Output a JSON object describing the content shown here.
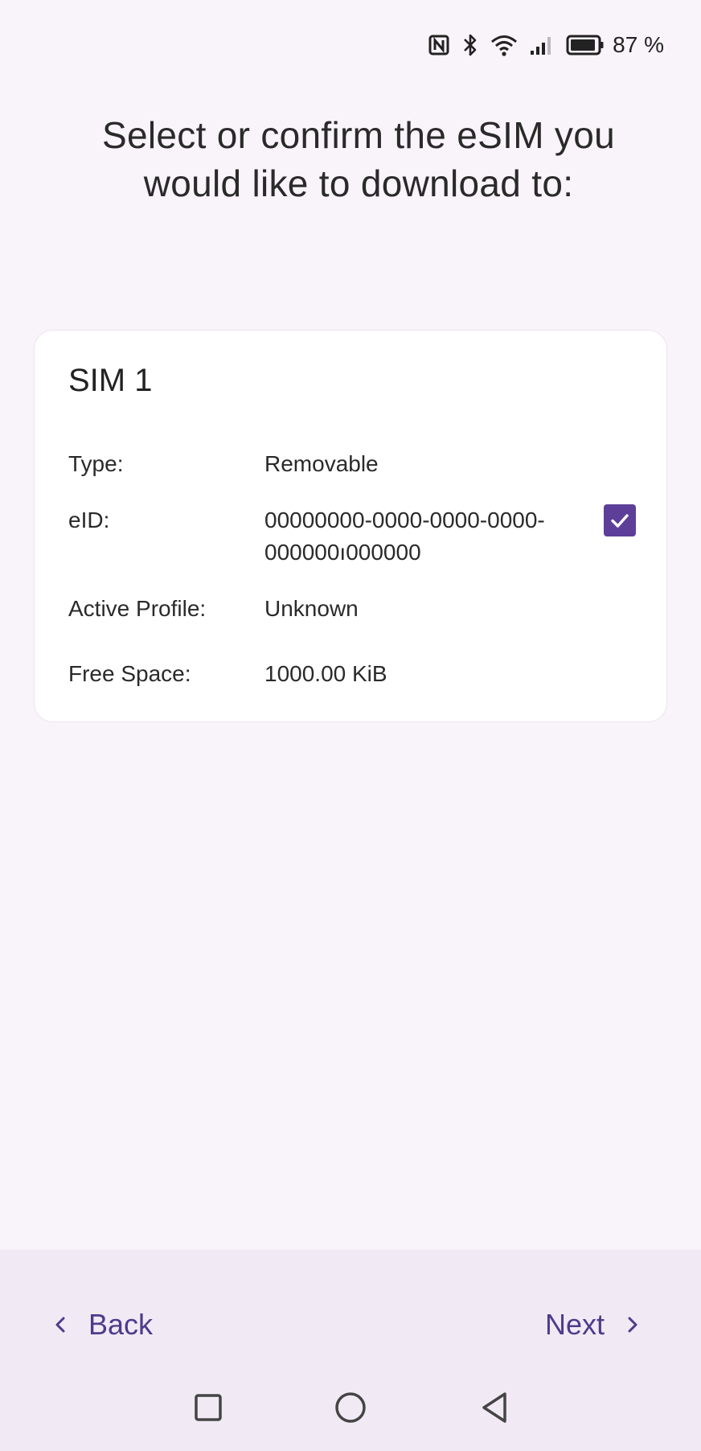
{
  "status_bar": {
    "icons": [
      "nfc-icon",
      "bluetooth-icon",
      "wifi-icon",
      "signal-icon",
      "battery-icon"
    ],
    "battery_percent": "87 %"
  },
  "page_title": "Select or confirm the eSIM you would like to download to:",
  "sim_card": {
    "title": "SIM 1",
    "rows": [
      {
        "label": "Type:",
        "value": "Removable"
      },
      {
        "label": "eID:",
        "value_line1": "00000000-0000-0000-0000-",
        "value_line2": "000000ı000000"
      },
      {
        "label": "Active Profile:",
        "value": "Unknown"
      },
      {
        "label": "Free Space:",
        "value": "1000.00 KiB"
      }
    ],
    "selected": true
  },
  "navigation": {
    "back_label": "Back",
    "next_label": "Next"
  },
  "system_nav": [
    "recents-icon",
    "home-icon",
    "back-triangle-icon"
  ],
  "colors": {
    "accent": "#5d3f99",
    "nav_text": "#4e3b8c",
    "background": "#f9f4f9",
    "bottom_bar": "#f1eaf4"
  }
}
